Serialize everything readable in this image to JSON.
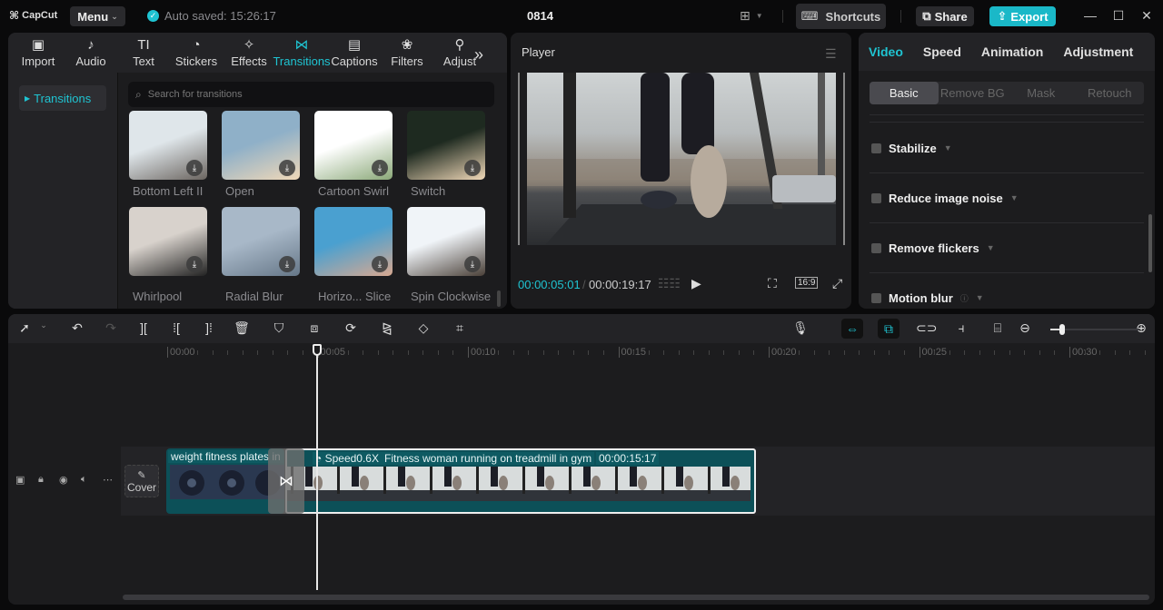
{
  "titlebar": {
    "logo": "CapCut",
    "menu_label": "Menu",
    "autosave": "Auto saved: 15:26:17",
    "project_name": "0814",
    "shortcuts_label": "Shortcuts",
    "share_label": "Share",
    "export_label": "Export",
    "accent": "#1fc4d2"
  },
  "media": {
    "tabs": [
      {
        "label": "Import",
        "icon": "▣"
      },
      {
        "label": "Audio",
        "icon": "♪"
      },
      {
        "label": "Text",
        "icon": "TI"
      },
      {
        "label": "Stickers",
        "icon": "◔"
      },
      {
        "label": "Effects",
        "icon": "✧"
      },
      {
        "label": "Transitions",
        "icon": "⋈"
      },
      {
        "label": "Captions",
        "icon": "▤"
      },
      {
        "label": "Filters",
        "icon": "❀"
      },
      {
        "label": "Adjust",
        "icon": "⚲"
      }
    ],
    "active_tab": "Transitions",
    "more": "»",
    "sidebar_item": "Transitions",
    "search_placeholder": "Search for transitions",
    "items": [
      {
        "label": "Bottom Left II"
      },
      {
        "label": "Open"
      },
      {
        "label": "Cartoon Swirl"
      },
      {
        "label": "Switch"
      },
      {
        "label": "Whirlpool"
      },
      {
        "label": "Radial Blur"
      },
      {
        "label": "Horizo... Slice"
      },
      {
        "label": "Spin Clockwise"
      }
    ]
  },
  "player": {
    "title": "Player",
    "current_time": "00:00:05:01",
    "separator": "/",
    "total_time": "00:00:19:17",
    "ratio": "16:9"
  },
  "inspector": {
    "tabs": [
      "Video",
      "Speed",
      "Animation",
      "Adjustment"
    ],
    "active_tab": "Video",
    "subtabs": [
      "Basic",
      "Remove BG",
      "Mask",
      "Retouch"
    ],
    "active_subtab": "Basic",
    "options": [
      {
        "label": "Stabilize",
        "checked": false
      },
      {
        "label": "Reduce image noise",
        "checked": false
      },
      {
        "label": "Remove flickers",
        "checked": false
      },
      {
        "label": "Motion blur",
        "checked": false,
        "help": "?"
      }
    ]
  },
  "timeline": {
    "ruler": [
      "00:00",
      "00:05",
      "00:10",
      "00:15",
      "00:20",
      "00:25",
      "00:30"
    ],
    "cover_label": "Cover",
    "clip1": {
      "title": "weight fitness plates in"
    },
    "clip2": {
      "speed": "Speed0.6X",
      "title": "Fitness woman running on treadmill in gym",
      "duration": "00:00:15:17"
    },
    "playhead_time": "00:00:05:01",
    "zoom_level": 0.1
  }
}
